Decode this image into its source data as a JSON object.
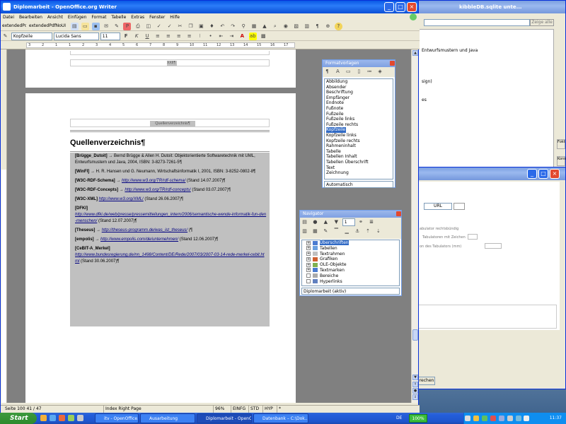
{
  "desktop": {
    "description_color": "#3a6ea5"
  },
  "bg_window1": {
    "title": "kibbleDB.sqlite unte...",
    "search_button": "Zeige alle",
    "lines": [
      "Entwurfsmustern und Java",
      "sign)",
      "es"
    ],
    "side_tabs": [
      "Fokt",
      "Kons"
    ]
  },
  "bg_window2": {
    "url_button": "URL",
    "labels": [
      "abulator rechtsbündig",
      "Tabulatoren mit Zeichen",
      "on des Tabulators (mm)"
    ],
    "bottom_button": "rechen"
  },
  "writer": {
    "title": "Diplomarbeit - OpenOffice.org Writer",
    "menu": [
      "Datei",
      "Bearbeiten",
      "Ansicht",
      "Einfügen",
      "Format",
      "Tabelle",
      "Extras",
      "Fenster",
      "Hilfe"
    ],
    "extended_buttons": [
      "extendedPdf",
      "extendedPdfNoUI"
    ],
    "style_value": "Kopfzeile",
    "font_value": "Lucida Sans",
    "size_value": "11",
    "ruler_numbers": [
      "3",
      "2",
      "1",
      "1",
      "2",
      "3",
      "4",
      "5",
      "6",
      "7",
      "8",
      "9",
      "10",
      "11",
      "12",
      "13",
      "14",
      "15",
      "16",
      "17"
    ],
    "header_page1": "XXII¶",
    "header_page2": "Quellenverzeichnis¶",
    "heading": "Quellenverzeichnis¶",
    "entries": [
      {
        "key": "[Brügge_Dutoit]",
        "text": " →  Bernd Brügge & Allen H. Dutoit: Objektorientierte Softwaretechnik mit UML, Entwurfsmustern und Java, 2004, ISBN: 3-8273-7261-5¶"
      },
      {
        "key": "[WinFI]",
        "text": " →  H. R. Hansen und G. Neumann, Wirtschaftsinformatik I, 2001, ISBN: 3-8252-0802-8¶"
      },
      {
        "key": "[W3C-RDF-Schema]",
        "text": " →  ",
        "link": "http://www.w3.org/TR/rdf-schema/",
        "tail": " (Stand 14.07.2007)¶"
      },
      {
        "key": "[W3C-RDF-Concepts]",
        "text": " →  ",
        "link": "http://www.w3.org/TR/rdf-concepts/",
        "tail": " (Stand 03.07.2007)¶"
      },
      {
        "key": "[W3C-XML]",
        "text": " ",
        "link": "http://www.w3.org/XML/",
        "tail": " (Stand 26.06.2007)¶"
      },
      {
        "key": "[DFKI]",
        "text": "",
        "link": "http://www.dfki.de/web/presse/pressemitteilungen_intern/2006/semantische-wende-informatik-fun-den-menschen/",
        "tail": " (Stand 12.07.2007)¶"
      },
      {
        "key": "[Theseus]",
        "text": " →  ",
        "link": "http://theseus-programm.de/was_ist_theseus/",
        "tail": " (¶"
      },
      {
        "key": "[empolis]",
        "text": " →  ",
        "link": "http://www.empolis.com/de/unternehmen/",
        "tail": " (Stand 12.06.2007)¶"
      },
      {
        "key": "[CeBIT-A_Merkel]",
        "text": "",
        "link": "http://www.bundesregierung.de/nn_1498/Content/DE/Rede/2007/03/2007-03-14-rede-merkel-cebit.html",
        "tail": " (Stand 30.06.2007)¶"
      }
    ],
    "status": {
      "page": "Seite 100 41 / 47",
      "page_style": "Index Right Page",
      "zoom": "96%",
      "mode1": "EINFG",
      "mode2": "STD",
      "mode3": "HYP",
      "mode4": "*"
    }
  },
  "formatvorlagen": {
    "title": "Formatvorlagen",
    "items": [
      "Abbildung",
      "Absender",
      "Beschriftung",
      "Empfänger",
      "Endnote",
      "Fußnote",
      "Fußzeile",
      "Fußzeile links",
      "Fußzeile rechts",
      "Kopfzeile",
      "Kopfzeile links",
      "Kopfzeile rechts",
      "Rahmeninhalt",
      "Tabelle",
      "Tabellen Inhalt",
      "Tabellen Überschrift",
      "Text",
      "Zeichnung"
    ],
    "selected_index": 9,
    "filter": "Automatisch"
  },
  "navigator": {
    "title": "Navigator",
    "page_value": "1",
    "items": [
      "Überschriften",
      "Tabellen",
      "Textrahmen",
      "Grafiken",
      "OLE-Objekte",
      "Textmarken",
      "Bereiche",
      "Hyperlinks"
    ],
    "document": "Diplomarbeit (aktiv)"
  },
  "taskbar": {
    "start": "Start",
    "tasks": [
      "itv - OpenOffice.org ...",
      "Ausarbeitung",
      "Diplomarbeit - OpenO...",
      "Datenbank – C:\\Dok..."
    ],
    "active_index": 2,
    "lang": "DE",
    "battery": "100%",
    "clock": "11:37"
  }
}
